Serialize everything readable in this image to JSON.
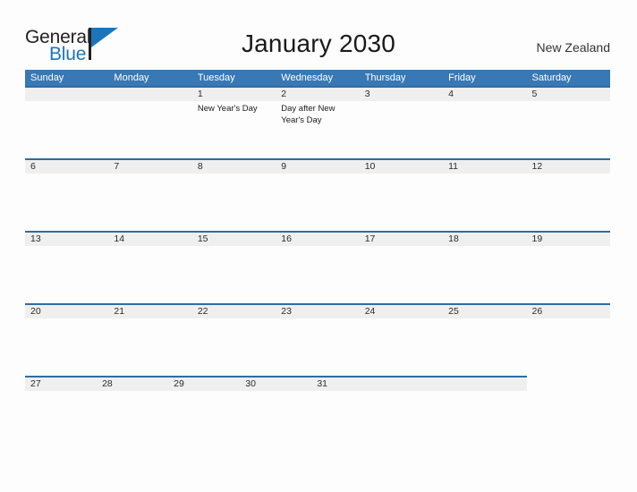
{
  "brand": {
    "name_part1": "General",
    "name_part2": "Blue",
    "flag_color": "#1b75bb",
    "text_color": "#231f20"
  },
  "header": {
    "title": "January 2030",
    "country": "New Zealand",
    "accent_color": "#3878b4",
    "band_color": "#efefef",
    "rule_color": "#2e6da4"
  },
  "weekdays": [
    "Sunday",
    "Monday",
    "Tuesday",
    "Wednesday",
    "Thursday",
    "Friday",
    "Saturday"
  ],
  "weeks": [
    {
      "days": [
        {
          "num": "",
          "events": []
        },
        {
          "num": "",
          "events": []
        },
        {
          "num": "1",
          "events": [
            "New Year's Day"
          ]
        },
        {
          "num": "2",
          "events": [
            "Day after New Year's Day"
          ]
        },
        {
          "num": "3",
          "events": []
        },
        {
          "num": "4",
          "events": []
        },
        {
          "num": "5",
          "events": []
        }
      ]
    },
    {
      "days": [
        {
          "num": "6",
          "events": []
        },
        {
          "num": "7",
          "events": []
        },
        {
          "num": "8",
          "events": []
        },
        {
          "num": "9",
          "events": []
        },
        {
          "num": "10",
          "events": []
        },
        {
          "num": "11",
          "events": []
        },
        {
          "num": "12",
          "events": []
        }
      ]
    },
    {
      "days": [
        {
          "num": "13",
          "events": []
        },
        {
          "num": "14",
          "events": []
        },
        {
          "num": "15",
          "events": []
        },
        {
          "num": "16",
          "events": []
        },
        {
          "num": "17",
          "events": []
        },
        {
          "num": "18",
          "events": []
        },
        {
          "num": "19",
          "events": []
        }
      ]
    },
    {
      "days": [
        {
          "num": "20",
          "events": []
        },
        {
          "num": "21",
          "events": []
        },
        {
          "num": "22",
          "events": []
        },
        {
          "num": "23",
          "events": []
        },
        {
          "num": "24",
          "events": []
        },
        {
          "num": "25",
          "events": []
        },
        {
          "num": "26",
          "events": []
        }
      ]
    },
    {
      "partial": true,
      "days": [
        {
          "num": "27",
          "events": []
        },
        {
          "num": "28",
          "events": []
        },
        {
          "num": "29",
          "events": []
        },
        {
          "num": "30",
          "events": []
        },
        {
          "num": "31",
          "events": []
        },
        {
          "num": "",
          "events": []
        },
        {
          "num": "",
          "events": []
        }
      ]
    }
  ]
}
